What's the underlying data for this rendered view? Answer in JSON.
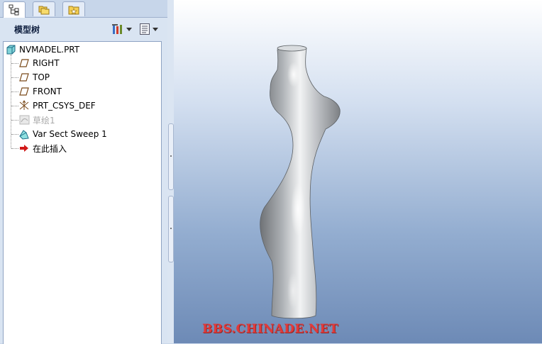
{
  "model_tree": {
    "title": "模型树",
    "items": [
      {
        "label": "NVMADEL.PRT",
        "icon": "part-icon",
        "disabled": false
      },
      {
        "label": "RIGHT",
        "icon": "datum-plane-icon",
        "disabled": false
      },
      {
        "label": "TOP",
        "icon": "datum-plane-icon",
        "disabled": false
      },
      {
        "label": "FRONT",
        "icon": "datum-plane-icon",
        "disabled": false
      },
      {
        "label": "PRT_CSYS_DEF",
        "icon": "coordinate-system-icon",
        "disabled": false
      },
      {
        "label": "草绘1",
        "icon": "sketch-icon",
        "disabled": true
      },
      {
        "label": "Var Sect Sweep 1",
        "icon": "sweep-feature-icon",
        "disabled": false
      },
      {
        "label": "在此插入",
        "icon": "insert-here-arrow-icon",
        "disabled": false
      }
    ]
  },
  "tabs": [
    {
      "icon": "model-tree-tab-icon",
      "active": true
    },
    {
      "icon": "folder-browser-tab-icon",
      "active": false
    },
    {
      "icon": "favorites-tab-icon",
      "active": false
    }
  ],
  "toolbar": {
    "settings_icon": "tree-settings-icon",
    "columns_icon": "show-columns-icon"
  },
  "viewport": {
    "watermark": "BBS.CHINADE.NET",
    "watermark_color": "#e23a3a",
    "model": "mannequin-torso"
  },
  "colors": {
    "panel_bg": "#d9e4f2",
    "viewport_bottom": "#6d8ab6"
  }
}
